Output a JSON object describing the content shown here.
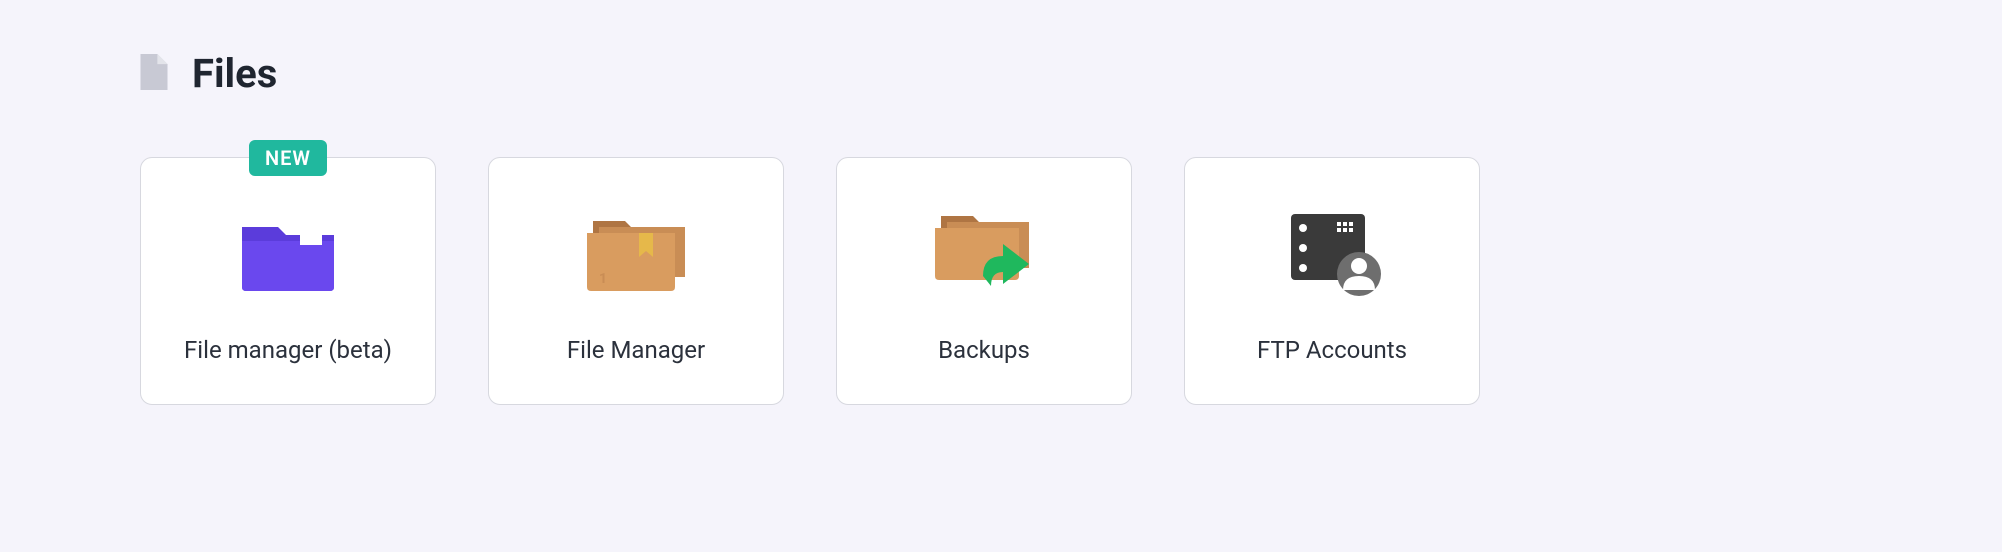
{
  "section": {
    "title": "Files"
  },
  "cards": [
    {
      "label": "File manager (beta)",
      "badge": "NEW",
      "icon": "folder-purple-icon"
    },
    {
      "label": "File Manager",
      "badge": null,
      "icon": "folder-brown-icon"
    },
    {
      "label": "Backups",
      "badge": null,
      "icon": "folder-arrow-icon"
    },
    {
      "label": "FTP Accounts",
      "badge": null,
      "icon": "server-user-icon"
    }
  ],
  "colors": {
    "badge_bg": "#20b89e",
    "card_bg": "#ffffff",
    "page_bg": "#f5f4fb"
  }
}
